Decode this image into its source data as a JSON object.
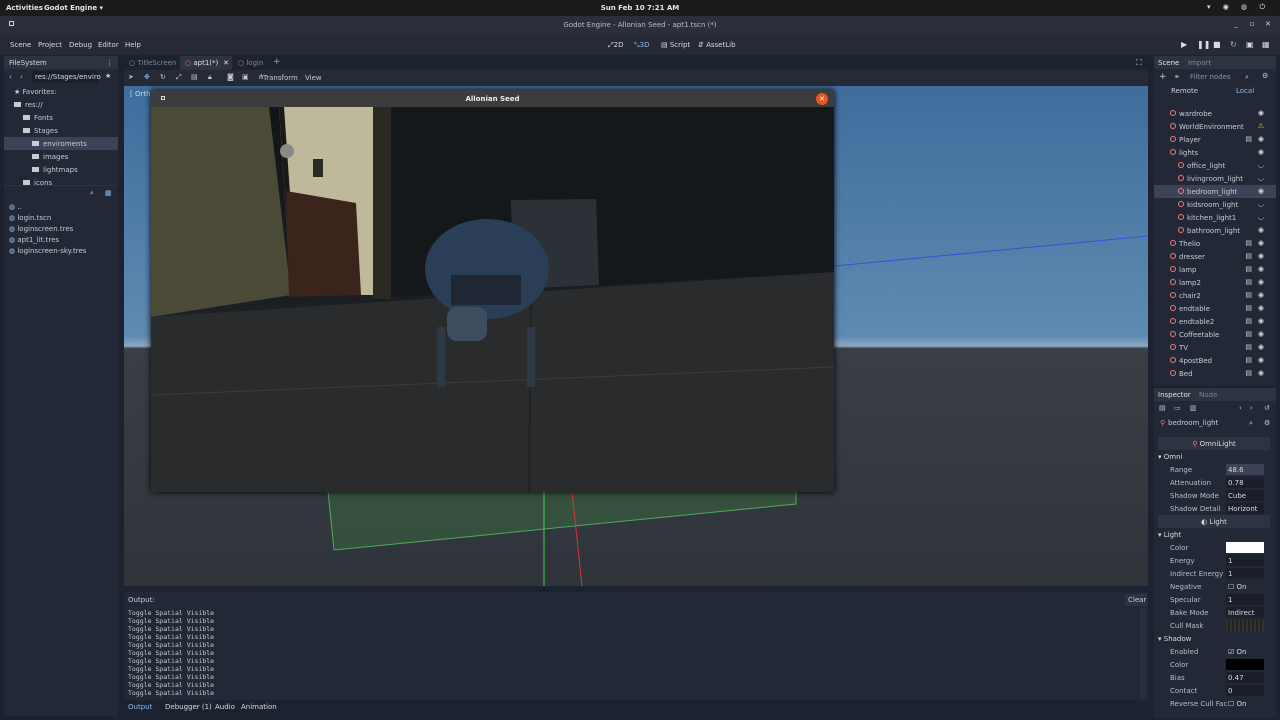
{
  "topbar": {
    "activities": "Activities",
    "app": "Godot Engine ▾",
    "clock": "Sun Feb 10   7:21 AM"
  },
  "window": {
    "title": "Godot Engine - Allonian Seed - apt1.tscn (*)"
  },
  "menu": [
    "Scene",
    "Project",
    "Debug",
    "Editor",
    "Help"
  ],
  "modes": {
    "d2": "2D",
    "d3": "3D",
    "script": "Script",
    "assetlib": "AssetLib"
  },
  "filesystem": {
    "title": "FileSystem",
    "path": "res://Stages/enviro",
    "tree": [
      {
        "label": "Favorites:",
        "indent": 0,
        "type": "star"
      },
      {
        "label": "res://",
        "indent": 0,
        "type": "folder"
      },
      {
        "label": "Fonts",
        "indent": 1,
        "type": "folder"
      },
      {
        "label": "Stages",
        "indent": 1,
        "type": "folder"
      },
      {
        "label": "enviroments",
        "indent": 2,
        "type": "folder",
        "selected": true
      },
      {
        "label": "images",
        "indent": 2,
        "type": "folder"
      },
      {
        "label": "lightmaps",
        "indent": 2,
        "type": "folder"
      },
      {
        "label": "icons",
        "indent": 1,
        "type": "folder"
      }
    ],
    "files": [
      "..",
      "login.tscn",
      "loginscreen.tres",
      "apt1_lit.tres",
      "loginscreen-sky.tres"
    ]
  },
  "tabs": [
    {
      "label": "TitleScreen",
      "active": false
    },
    {
      "label": "apt1(*)",
      "active": true
    },
    {
      "label": "login",
      "active": false
    }
  ],
  "viewport": {
    "transform": "Transform",
    "view": "View",
    "ortho": "[ Ortho"
  },
  "game": {
    "title": "Allonian Seed"
  },
  "output": {
    "label": "Output:",
    "clear": "Clear",
    "lines": [
      "Toggle Spatial Visible",
      "Toggle Spatial Visible",
      "Toggle Spatial Visible",
      "Toggle Spatial Visible",
      "Toggle Spatial Visible",
      "Toggle Spatial Visible",
      "Toggle Spatial Visible",
      "Toggle Spatial Visible",
      "Toggle Spatial Visible",
      "Toggle Spatial Visible",
      "Toggle Spatial Visible"
    ],
    "tabs": [
      "Output",
      "Debugger (1)",
      "Audio",
      "Animation"
    ]
  },
  "scene": {
    "tab1": "Scene",
    "tab2": "Import",
    "filter": "Filter nodes",
    "remote": "Remote",
    "local": "Local",
    "nodes": [
      {
        "label": "wardrobe",
        "indent": 0,
        "eye": true,
        "script": false
      },
      {
        "label": "WorldEnvironment",
        "indent": 0,
        "eye": false,
        "script": false,
        "warn": true
      },
      {
        "label": "Player",
        "indent": 0,
        "eye": true,
        "script": true
      },
      {
        "label": "lights",
        "indent": 0,
        "eye": true,
        "script": false
      },
      {
        "label": "office_light",
        "indent": 1,
        "eye": false,
        "script": false
      },
      {
        "label": "livingroom_light",
        "indent": 1,
        "eye": false,
        "script": false
      },
      {
        "label": "bedroom_light",
        "indent": 1,
        "eye": true,
        "script": false,
        "selected": true
      },
      {
        "label": "kidsroom_light",
        "indent": 1,
        "eye": false,
        "script": false
      },
      {
        "label": "kitchen_light1",
        "indent": 1,
        "eye": false,
        "script": false
      },
      {
        "label": "bathroom_light",
        "indent": 1,
        "eye": true,
        "script": false
      },
      {
        "label": "Thelio",
        "indent": 0,
        "eye": true,
        "script": true
      },
      {
        "label": "dresser",
        "indent": 0,
        "eye": true,
        "script": true
      },
      {
        "label": "lamp",
        "indent": 0,
        "eye": true,
        "script": true
      },
      {
        "label": "lamp2",
        "indent": 0,
        "eye": true,
        "script": true
      },
      {
        "label": "chair2",
        "indent": 0,
        "eye": true,
        "script": true
      },
      {
        "label": "endtable",
        "indent": 0,
        "eye": true,
        "script": true
      },
      {
        "label": "endtable2",
        "indent": 0,
        "eye": true,
        "script": true
      },
      {
        "label": "Coffeetable",
        "indent": 0,
        "eye": true,
        "script": true
      },
      {
        "label": "TV",
        "indent": 0,
        "eye": true,
        "script": true
      },
      {
        "label": "4postBed",
        "indent": 0,
        "eye": true,
        "script": true
      },
      {
        "label": "Bed",
        "indent": 0,
        "eye": true,
        "script": true
      }
    ]
  },
  "inspector": {
    "tab1": "Inspector",
    "tab2": "Node",
    "object": "bedroom_light",
    "class": "OmniLight",
    "omni": {
      "group": "Omni",
      "range_k": "Range",
      "range": "48.6",
      "att_k": "Attenuation",
      "att": "0.78",
      "sm_k": "Shadow Mode",
      "sm": "Cube",
      "sd_k": "Shadow Detail",
      "sd": "Horizont"
    },
    "light": {
      "section": "Light",
      "group": "Light",
      "color_k": "Color",
      "color": "#ffffff",
      "energy_k": "Energy",
      "energy": "1",
      "ie_k": "Indirect Energy",
      "ie": "1",
      "neg_k": "Negative",
      "neg": "On",
      "spec_k": "Specular",
      "spec": "1",
      "bake_k": "Bake Mode",
      "bake": "Indirect",
      "cull_k": "Cull Mask"
    },
    "shadow": {
      "group": "Shadow",
      "en_k": "Enabled",
      "en": "On",
      "col_k": "Color",
      "col": "#000000",
      "bias_k": "Bias",
      "bias": "0.47",
      "contact_k": "Contact",
      "contact": "0",
      "rev_k": "Reverse Cull Fac",
      "rev": "On"
    }
  }
}
